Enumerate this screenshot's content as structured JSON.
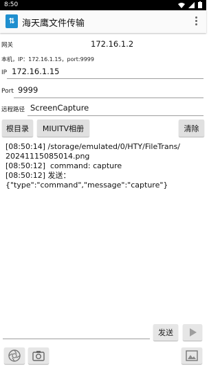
{
  "status": {
    "time": "8:50"
  },
  "app": {
    "title": "海天鹰文件传输",
    "logo_glyph": "⇅"
  },
  "gateway": {
    "label": "网关",
    "value": "172.16.1.2"
  },
  "local": {
    "text": "本机，IP：172.16.1.15，port:9999"
  },
  "ip": {
    "label": "IP",
    "value": "172.16.1.15"
  },
  "port": {
    "label": "Port",
    "value": "9999"
  },
  "remote": {
    "label": "远程路径",
    "value": "ScreenCapture"
  },
  "buttons": {
    "root": "根目录",
    "album": "MIUITV相册",
    "clear": "清除"
  },
  "log": [
    "[08:50:14] /storage/emulated/0/HTY/FileTrans/",
    "20241115085014.png",
    "[08:50:12]  command: capture",
    "[08:50:12] 发送：",
    "{\"type\":\"command\",\"message\":\"capture\"}"
  ],
  "bottom": {
    "send_label": "发送",
    "send_value": ""
  }
}
